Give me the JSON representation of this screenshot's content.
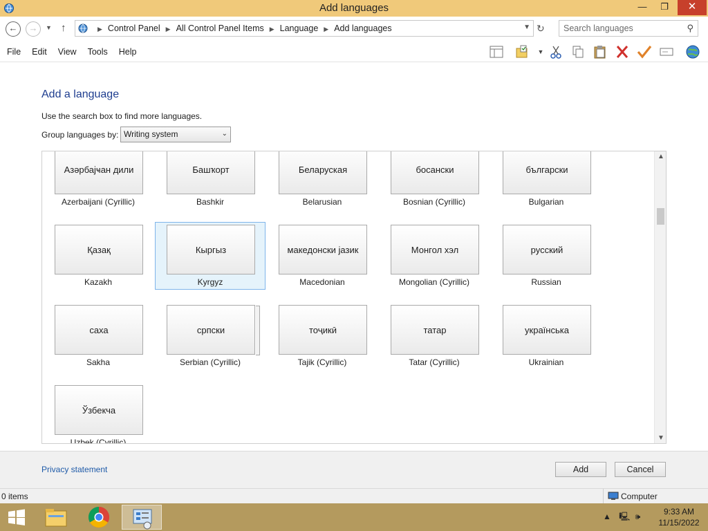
{
  "window": {
    "title": "Add languages",
    "min_glyph": "—",
    "max_glyph": "❐",
    "close_glyph": "✕"
  },
  "address": {
    "breadcrumbs": [
      "Control Panel",
      "All Control Panel Items",
      "Language",
      "Add languages"
    ],
    "search_placeholder": "Search languages"
  },
  "menu": [
    "File",
    "Edit",
    "View",
    "Tools",
    "Help"
  ],
  "toolbar_icons": [
    "pane-icon",
    "properties-folder-icon",
    "cut-icon",
    "copy-icon",
    "paste-icon",
    "delete-icon",
    "check-icon",
    "rename-icon",
    "globe-icon"
  ],
  "content": {
    "heading": "Add a language",
    "hint": "Use the search box to find more languages.",
    "group_label": "Group languages by:",
    "group_value": "Writing system"
  },
  "languages": [
    {
      "native": "Азәрбајҹан дили",
      "english": "Azerbaijani (Cyrillic)"
    },
    {
      "native": "Башҡорт",
      "english": "Bashkir"
    },
    {
      "native": "Беларуская",
      "english": "Belarusian"
    },
    {
      "native": "босански",
      "english": "Bosnian (Cyrillic)"
    },
    {
      "native": "български",
      "english": "Bulgarian"
    },
    {
      "native": "Қазақ",
      "english": "Kazakh"
    },
    {
      "native": "Кыргыз",
      "english": "Kyrgyz",
      "selected": true
    },
    {
      "native": "македонски јазик",
      "english": "Macedonian"
    },
    {
      "native": "Монгол хэл",
      "english": "Mongolian (Cyrillic)"
    },
    {
      "native": "русский",
      "english": "Russian"
    },
    {
      "native": "саха",
      "english": "Sakha"
    },
    {
      "native": "српски",
      "english": "Serbian (Cyrillic)",
      "stacked": true
    },
    {
      "native": "тоҷикӣ",
      "english": "Tajik (Cyrillic)"
    },
    {
      "native": "татар",
      "english": "Tatar (Cyrillic)"
    },
    {
      "native": "українська",
      "english": "Ukrainian"
    },
    {
      "native": "Ўзбекча",
      "english": "Uzbek (Cyrillic)"
    }
  ],
  "footer": {
    "privacy": "Privacy statement",
    "add": "Add",
    "cancel": "Cancel"
  },
  "status": {
    "items": "0 items",
    "location": "Computer"
  },
  "taskbar": {
    "time": "9:33 AM",
    "date": "11/15/2022",
    "apps": [
      "file-explorer-icon",
      "chrome-icon",
      "control-panel-icon"
    ]
  },
  "colors": {
    "titlebar": "#f0c97a",
    "taskbar": "#b49a5e",
    "heading": "#1e3d8f",
    "link": "#1e5aa8",
    "close": "#c7402b"
  }
}
